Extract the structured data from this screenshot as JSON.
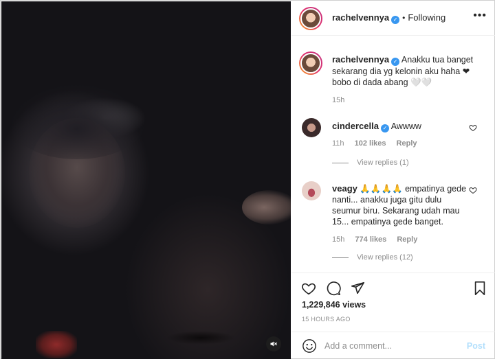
{
  "header": {
    "username": "rachelvennya",
    "separator": "•",
    "following_label": "Following",
    "more_icon": "more-horizontal-icon"
  },
  "caption": {
    "username": "rachelvennya",
    "text": "Anakku tua banget sekarang dia yg kelonin aku haha ❤ bobo di dada abang 🤍🤍",
    "time": "15h"
  },
  "comments": [
    {
      "username": "cindercella",
      "verified": true,
      "text": "Awwww",
      "time": "11h",
      "likes": "102 likes",
      "reply_label": "Reply",
      "view_replies": "View replies (1)"
    },
    {
      "username": "veagy",
      "verified": false,
      "text": "🙏🙏🙏🙏 empatinya gede nanti... anakku juga gitu dulu seumur biru. Sekarang udah mau 15... empatinya gede banget.",
      "time": "15h",
      "likes": "774 likes",
      "reply_label": "Reply",
      "view_replies": "View replies (12)"
    }
  ],
  "actions": {
    "views": "1,229,846 views",
    "time_ago": "15 HOURS AGO"
  },
  "add_comment": {
    "placeholder": "Add a comment...",
    "post_label": "Post"
  },
  "colors": {
    "link_blue": "#3897f0",
    "post_disabled": "#b2dffc",
    "muted_text": "#8e8e8e"
  }
}
